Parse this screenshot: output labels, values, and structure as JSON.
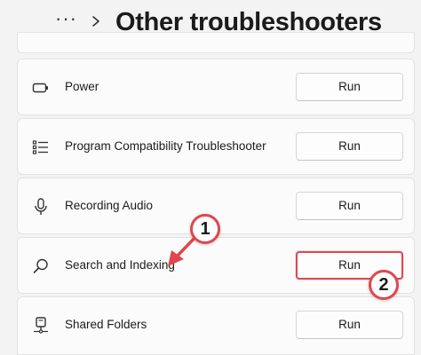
{
  "header": {
    "more_label": "···",
    "title": "Other troubleshooters"
  },
  "items": [
    {
      "label": "Power",
      "button": "Run",
      "icon": "battery-icon"
    },
    {
      "label": "Program Compatibility Troubleshooter",
      "button": "Run",
      "icon": "list-icon"
    },
    {
      "label": "Recording Audio",
      "button": "Run",
      "icon": "microphone-icon"
    },
    {
      "label": "Search and Indexing",
      "button": "Run",
      "icon": "search-icon"
    },
    {
      "label": "Shared Folders",
      "button": "Run",
      "icon": "network-drive-icon"
    }
  ],
  "annotations": {
    "step1": "1",
    "step2": "2"
  },
  "colors": {
    "annotation": "#e0474f",
    "background": "#f3f3f3",
    "card": "#fbfbfb"
  }
}
